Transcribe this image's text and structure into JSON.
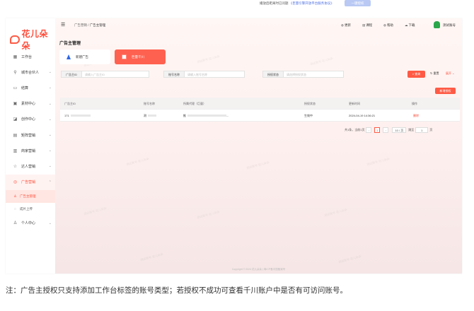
{
  "topbar": {
    "notice_prefix": "播放后距离时已问题",
    "notice_link": "《巨量引擎开放平台服务协议》",
    "ghost_button": "一键授权"
  },
  "brand": {
    "logo_text": "花儿朵朵"
  },
  "sidebar": {
    "items": [
      {
        "icon": "workbench-icon",
        "glyph": "▦",
        "label": "工作台",
        "chevron": false
      },
      {
        "icon": "partner-icon",
        "glyph": "⚲",
        "label": "城市合伙人",
        "chevron": true
      },
      {
        "icon": "settle-icon",
        "glyph": "▭",
        "label": "结算",
        "chevron": true
      },
      {
        "icon": "material-icon",
        "glyph": "▣",
        "label": "素材中心",
        "chevron": true
      },
      {
        "icon": "creative-icon",
        "glyph": "◪",
        "label": "创作中心",
        "chevron": true
      },
      {
        "icon": "team-icon",
        "glyph": "▤",
        "label": "矩阵营销",
        "chevron": true
      },
      {
        "icon": "merchant-icon",
        "glyph": "▥",
        "label": "商家营销",
        "chevron": true
      },
      {
        "icon": "expert-icon",
        "glyph": "☆",
        "label": "达人营销",
        "chevron": true
      },
      {
        "icon": "ad-icon",
        "glyph": "◎",
        "label": "广告营销",
        "chevron": true
      }
    ],
    "subitems": [
      {
        "glyph": "♙",
        "label": "广告主管理"
      },
      {
        "glyph": "◌",
        "label": "成片上传"
      }
    ],
    "personal": {
      "glyph": "♙",
      "label": "个人中心"
    }
  },
  "header": {
    "breadcrumb_root": "广告营销",
    "breadcrumb_sep": "/",
    "breadcrumb_current": "广告主管理",
    "actions": [
      {
        "icon": "update-icon",
        "glyph": "◍",
        "label": "更新"
      },
      {
        "icon": "course-icon",
        "glyph": "▤",
        "label": "课程"
      },
      {
        "icon": "help-icon",
        "glyph": "◍",
        "label": "帮助"
      },
      {
        "icon": "download-icon",
        "glyph": "☁",
        "label": "下载"
      }
    ],
    "user_name": "测试账号"
  },
  "page_title": "广告主管理",
  "cards": [
    {
      "label": "新建广告"
    },
    {
      "label": "巨量千川"
    }
  ],
  "filters": [
    {
      "label": "广告主ID",
      "placeholder": "请输入广告主ID"
    },
    {
      "label": "账号名称",
      "placeholder": "请输入账号名称"
    },
    {
      "label": "授权状态",
      "placeholder": "请选择授权状态"
    }
  ],
  "buttons": {
    "query": "查询",
    "reset": "重置",
    "expand": "展开",
    "add": "新增授权"
  },
  "table": {
    "columns": [
      "广告主ID",
      "账号名称",
      "所属代理（巨量）",
      "授权状态",
      "更新时间",
      "操作"
    ],
    "rows": [
      {
        "id": "171",
        "name": "测",
        "agency": "推",
        "agency_suffix": "...",
        "status": "生效中",
        "updated": "2024-04-19 14:36:21",
        "op": "删除"
      }
    ]
  },
  "pagination": {
    "total_text": "共1条，当前1页",
    "prev": "‹",
    "current": "1",
    "next": "›",
    "page_size": "10 / 页",
    "jump_label": "跳至",
    "jump_value": "1",
    "page_unit": "页"
  },
  "footer": "Copyright © 2024 花儿朵朵 | 粤ICP备中国备案号",
  "watermark": "测试账号 花儿朵朵",
  "note": "注：广告主授权只支持添加工作台标签的账号类型；若授权不成功可查看千川账户中是否有可访问账号。",
  "colors": {
    "accent": "#ff5a45",
    "brand_blue": "#2d66e8"
  }
}
